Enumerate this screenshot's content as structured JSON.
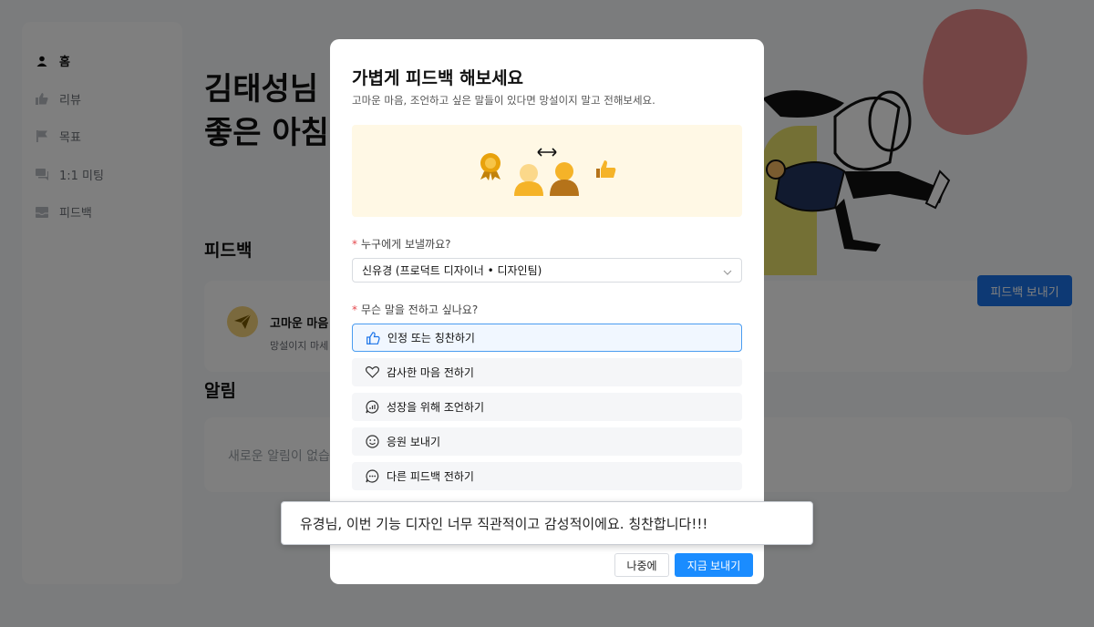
{
  "sidebar": {
    "items": [
      {
        "label": "홈",
        "icon": "person-icon",
        "active": true
      },
      {
        "label": "리뷰",
        "icon": "thumbs-up-icon",
        "active": false
      },
      {
        "label": "목표",
        "icon": "flag-icon",
        "active": false
      },
      {
        "label": "1:1 미팅",
        "icon": "chat-icon",
        "active": false
      },
      {
        "label": "피드백",
        "icon": "inbox-icon",
        "active": false
      }
    ]
  },
  "main": {
    "greeting": "김태성님\n좋은 아침",
    "feedback_section_title": "피드백",
    "feedback_card": {
      "title": "고마운 마음",
      "subtitle": "망설이지 마세",
      "send_button": "피드백 보내기"
    },
    "notice_section_title": "알림",
    "notice_empty": "새로운 알림이 없습"
  },
  "modal": {
    "title": "가볍게 피드백 해보세요",
    "subtitle": "고마운 마음, 조언하고 싶은 말들이 있다면 망설이지 말고 전해보세요.",
    "recipient_label": "누구에게 보낼까요?",
    "recipient_value": "신유경 (프로덕트 디자이너 • 디자인팀)",
    "message_label": "무슨 말을 전하고 싶나요?",
    "options": [
      {
        "label": "인정 또는 칭찬하기",
        "icon": "thumbs-up-icon",
        "selected": true
      },
      {
        "label": "감사한 마음 전하기",
        "icon": "heart-icon",
        "selected": false
      },
      {
        "label": "성장을 위해 조언하기",
        "icon": "chat-chart-icon",
        "selected": false
      },
      {
        "label": "응원 보내기",
        "icon": "smile-icon",
        "selected": false
      },
      {
        "label": "다른 피드백 전하기",
        "icon": "chat-dots-icon",
        "selected": false
      }
    ],
    "later_button": "나중에",
    "send_now_button": "지금 보내기"
  },
  "message_input": {
    "value": "유경님, 이번 기능 디자인 너무 직관적이고 감성적이에요. 칭찬합니다!!!"
  },
  "colors": {
    "primary": "#1a8cff",
    "banner_bg": "#fff8e5",
    "required": "#e5484d",
    "selected_border": "#4a9cf0"
  }
}
